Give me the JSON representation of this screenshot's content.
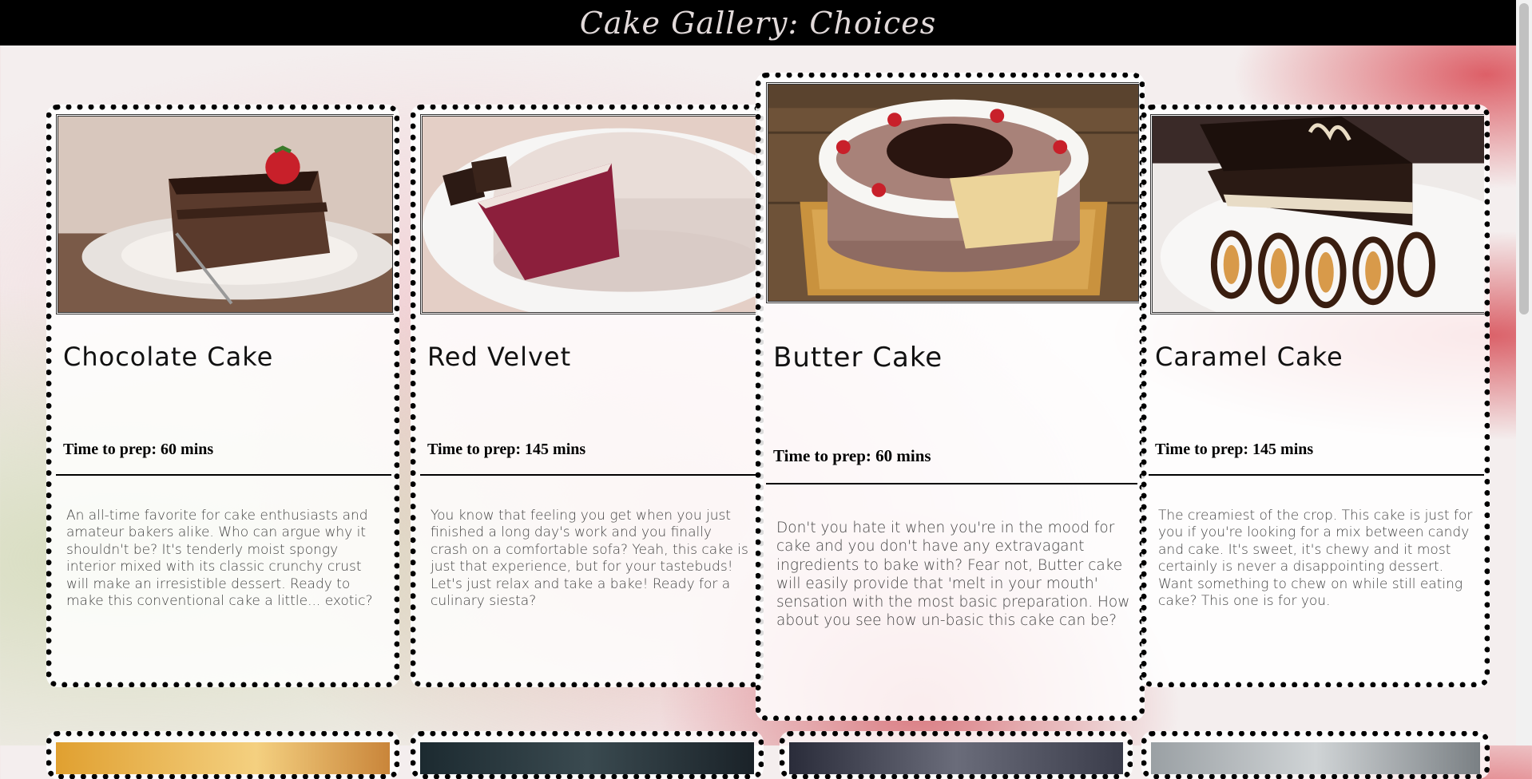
{
  "header": {
    "title": "Cake Gallery: Choices"
  },
  "cards": [
    {
      "name": "Chocolate Cake",
      "prep": "Time to prep: 60 mins",
      "description": "An all-time favorite for cake enthusiasts and amateur bakers alike. Who can argue why it shouldn't be? It's tenderly moist spongy interior mixed with its classic crunchy crust will make an irresistible dessert. Ready to make this conventional cake a little... exotic?"
    },
    {
      "name": "Red Velvet",
      "prep": "Time to prep: 145 mins",
      "description": "You know that feeling you get when you just finished a long day's work and you finally crash on a comfortable sofa? Yeah, this cake is just that experience, but for your tastebuds! Let's just relax and take a bake! Ready for a culinary siesta?"
    },
    {
      "name": "Butter Cake",
      "prep": "Time to prep: 60 mins",
      "description": "Don't you hate it when you're in the mood for cake and you don't have any extravagant ingredients to bake with? Fear not, Butter cake will easily provide that 'melt in your mouth' sensation with the most basic preparation. How about you see how un-basic this cake can be?"
    },
    {
      "name": "Caramel Cake",
      "prep": "Time to prep: 145 mins",
      "description": "The creamiest of the crop. This cake is just for you if you're looking for a mix between candy and cake. It's sweet, it's chewy and it most certainly is never a disappointing dessert. Want something to chew on while still eating cake? This one is for you."
    }
  ]
}
